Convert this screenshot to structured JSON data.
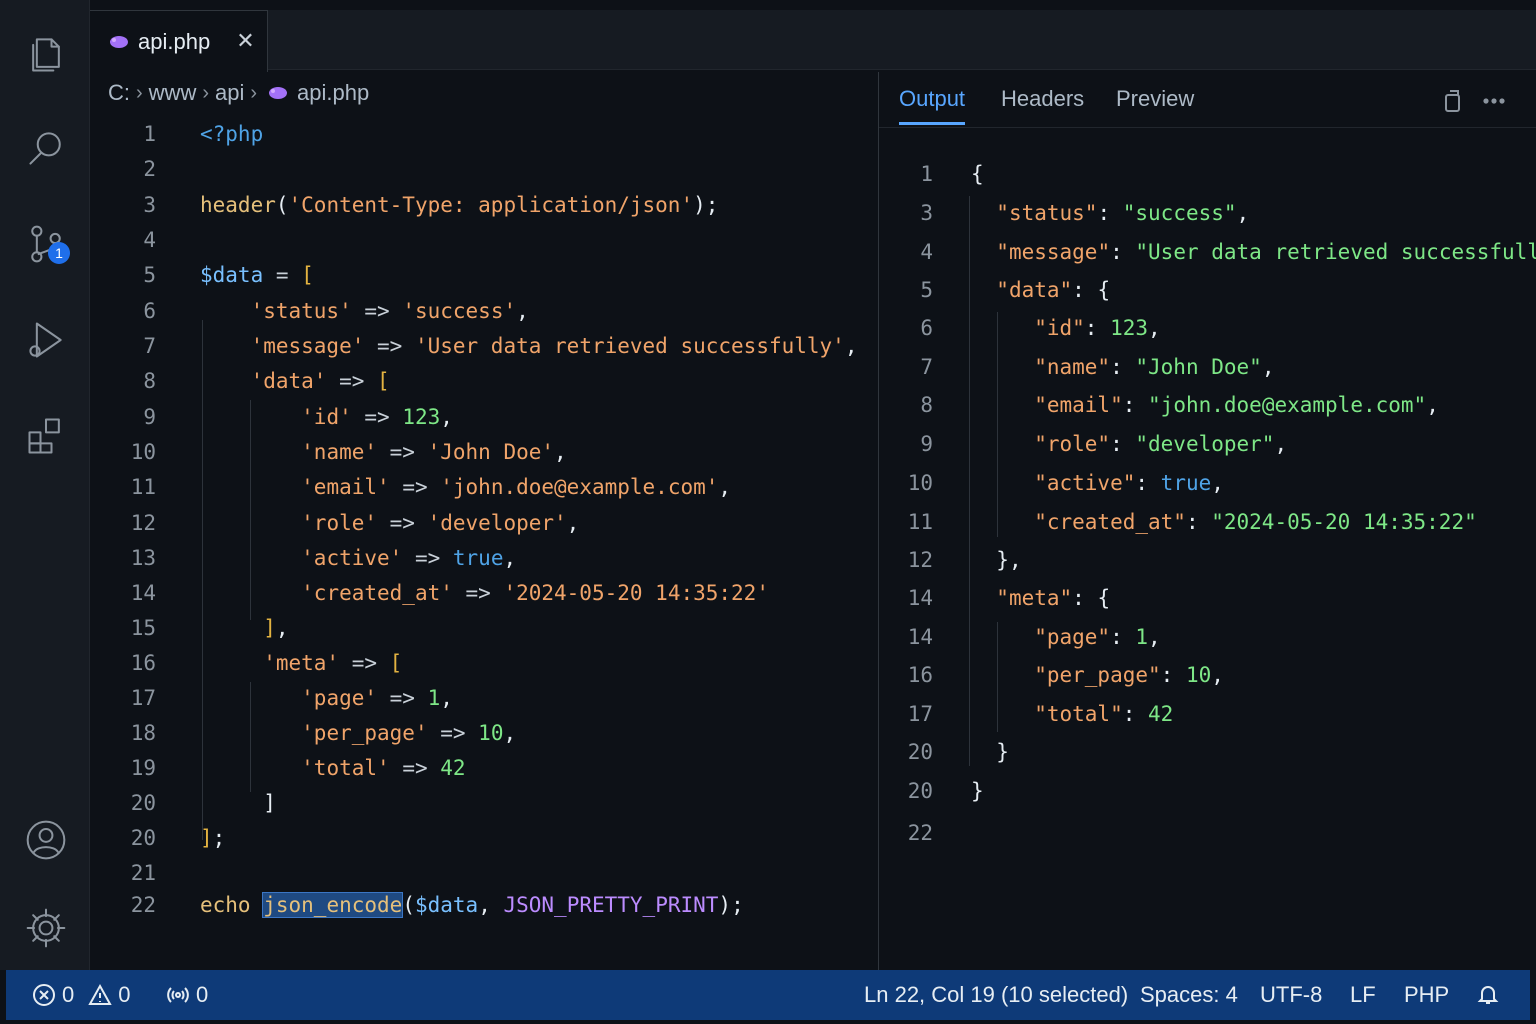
{
  "tab": {
    "label": "api.php",
    "close": "✕"
  },
  "breadcrumb": [
    "C:",
    "www",
    "api",
    "api.php"
  ],
  "breadcrumb_sep": "›",
  "editor": {
    "lines": [
      {
        "n": "1"
      },
      {
        "n": "2"
      },
      {
        "n": "3"
      },
      {
        "n": "4"
      },
      {
        "n": "5"
      },
      {
        "n": "6"
      },
      {
        "n": "7"
      },
      {
        "n": "8"
      },
      {
        "n": "9"
      },
      {
        "n": "10"
      },
      {
        "n": "11"
      },
      {
        "n": "12"
      },
      {
        "n": "13"
      },
      {
        "n": "14"
      },
      {
        "n": "15"
      },
      {
        "n": "16"
      },
      {
        "n": "17"
      },
      {
        "n": "18"
      },
      {
        "n": "19"
      },
      {
        "n": "20"
      },
      {
        "n": "20"
      },
      {
        "n": "21"
      },
      {
        "n": "22"
      }
    ],
    "t": {
      "php_open": "<?php",
      "header_fn": "header",
      "header_arg": "'Content-Type: application/json'",
      "data_var": "$data",
      "k_status": "'status'",
      "v_status": "'success'",
      "k_message": "'message'",
      "v_message": "'User data retrieved successfully'",
      "k_data": "'data'",
      "k_id": "'id'",
      "v_id": "123",
      "k_name": "'name'",
      "v_name": "'John Doe'",
      "k_email": "'email'",
      "v_email": "'john.doe@example.com'",
      "k_role": "'role'",
      "v_role": "'developer'",
      "k_active": "'active'",
      "v_active": "true",
      "k_created": "'created_at'",
      "v_created": "'2024-05-20 14:35:22'",
      "k_meta": "'meta'",
      "k_page": "'page'",
      "v_page": "1",
      "k_per_page": "'per_page'",
      "v_per_page": "10",
      "k_total": "'total'",
      "v_total": "42",
      "echo": "echo",
      "json_encode": "json_encode",
      "pretty": "JSON_PRETTY_PRINT"
    }
  },
  "panel": {
    "tabs": [
      "Output",
      "Headers",
      "Preview"
    ],
    "active_tab": "Output",
    "line_numbers": [
      "1",
      "3",
      "4",
      "5",
      "6",
      "7",
      "8",
      "9",
      "10",
      "11",
      "12",
      "14",
      "14",
      "16",
      "17",
      "20",
      "20",
      "22"
    ],
    "json": {
      "k_status": "\"status\"",
      "v_status": "\"success\"",
      "k_message": "\"message\"",
      "v_message": "\"User data retrieved successfully\"",
      "k_data": "\"data\"",
      "k_id": "\"id\"",
      "v_id": "123",
      "k_name": "\"name\"",
      "v_name": "\"John Doe\"",
      "k_email": "\"email\"",
      "v_email": "\"john.doe@example.com\"",
      "k_role": "\"role\"",
      "v_role": "\"developer\"",
      "k_active": "\"active\"",
      "v_active": "true",
      "k_created": "\"created_at\"",
      "v_created": "\"2024-05-20 14:35:22\"",
      "k_meta": "\"meta\"",
      "k_page": "\"page\"",
      "v_page": "1",
      "k_per_page": "\"per_page\"",
      "v_per_page": "10",
      "k_total": "\"total\"",
      "v_total": "42"
    }
  },
  "activity": {
    "icons": [
      "files-icon",
      "search-icon",
      "source-control-icon",
      "run-debug-icon",
      "extensions-icon",
      "account-icon",
      "settings-gear-icon"
    ],
    "scm_badge": "1"
  },
  "status": {
    "errors": "0",
    "warnings": "0",
    "ports": "0",
    "cursor": "Ln 22, Col 19 (10 selected)",
    "spaces": "Spaces: 4",
    "encoding": "UTF-8",
    "eol": "LF",
    "language": "PHP"
  },
  "colors": {
    "accent": "#58a6ff",
    "statusbar": "#0e3a78",
    "selection": "#1f4a82"
  }
}
